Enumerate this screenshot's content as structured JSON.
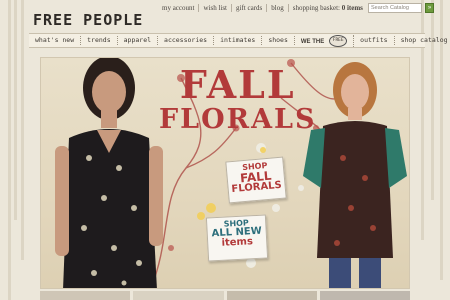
{
  "brand": {
    "logo": "FREE PEOPLE"
  },
  "utility_nav": {
    "links": [
      "my account",
      "wish list",
      "gift cards",
      "blog"
    ],
    "basket_label": "shopping basket:",
    "basket_count": "0 items"
  },
  "search": {
    "placeholder": "Search Catalog",
    "go": "»"
  },
  "main_nav": {
    "items": [
      "what's new",
      "trends",
      "apparel",
      "accessories",
      "intimates",
      "shoes"
    ],
    "we_the": "WE THE",
    "we_the_badge": "FREE",
    "items2": [
      "outfits",
      "shop catalog"
    ]
  },
  "hero": {
    "headline_1": "FALL",
    "headline_2": "FLORALS",
    "cta1": {
      "line1": "SHOP",
      "line2": "FALL",
      "line3": "FLORALS"
    },
    "cta2": {
      "line1": "SHOP",
      "line2": "ALL NEW",
      "line3": "items"
    }
  },
  "colors": {
    "accent_red": "#b23a3a",
    "teal": "#2d6f7c",
    "go_green": "#6d9a3c"
  }
}
